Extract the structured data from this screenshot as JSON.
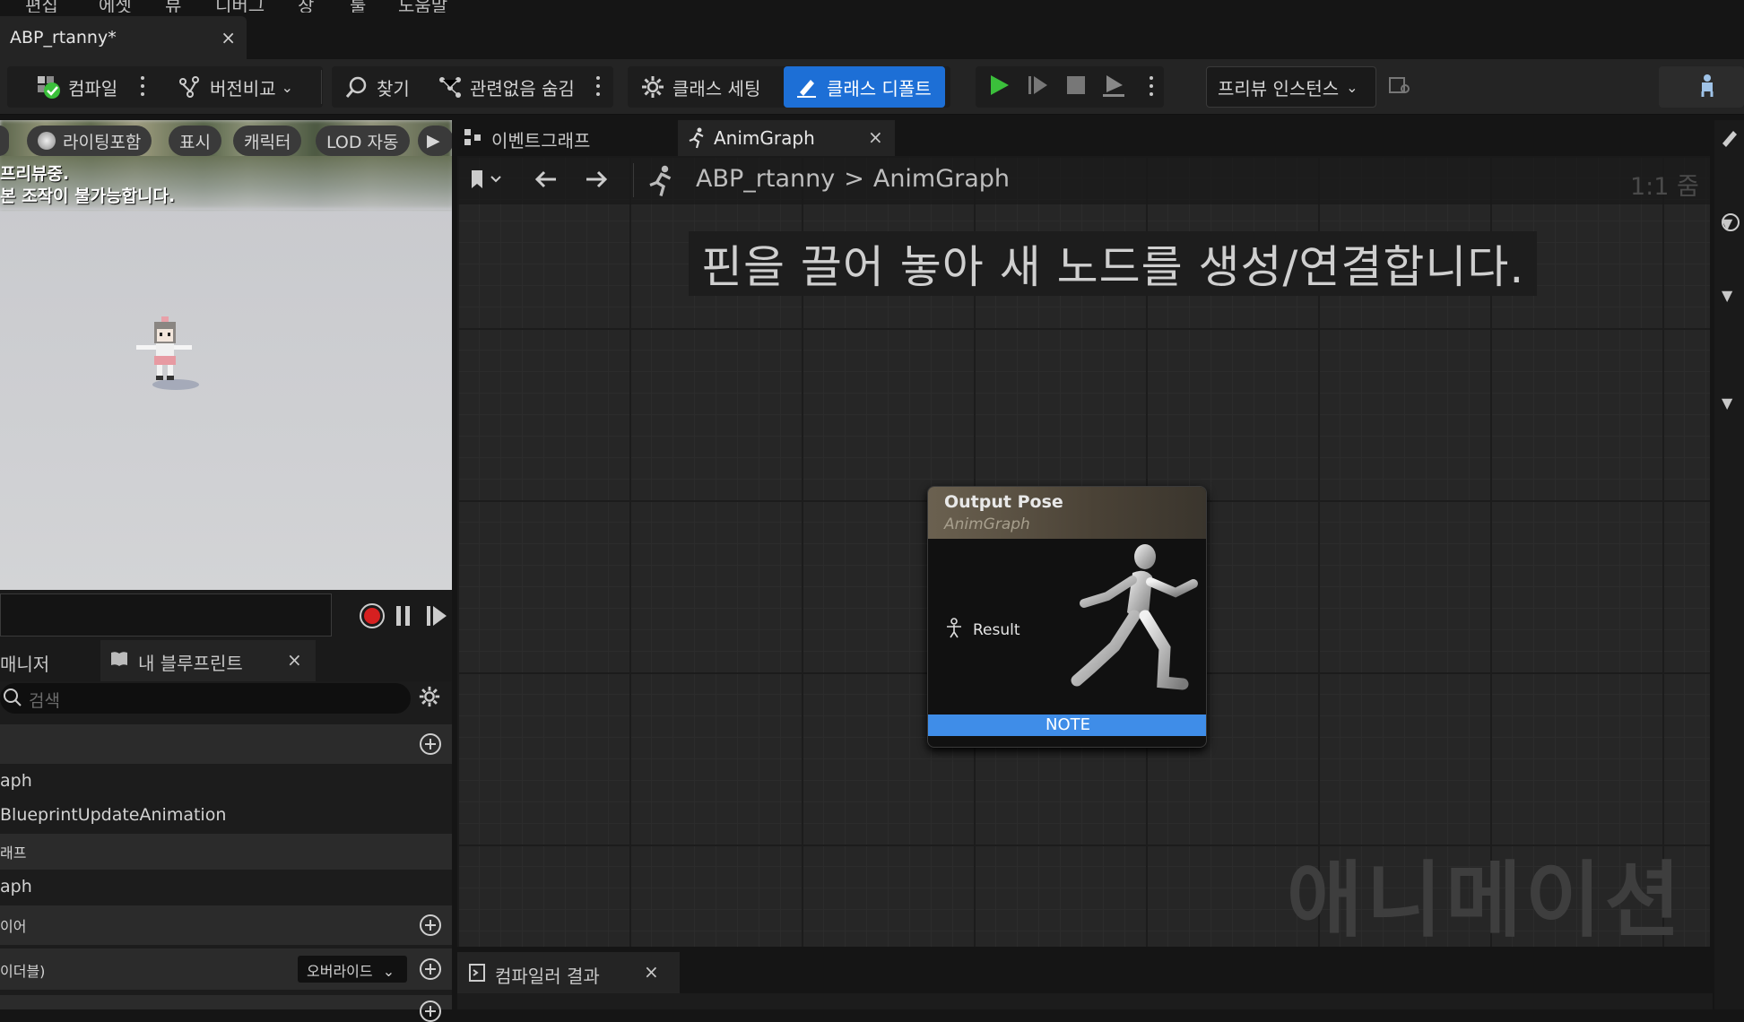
{
  "menu": [
    "편집",
    "에셋",
    "뷰",
    "디버그",
    "창",
    "툴",
    "도움말"
  ],
  "document_tab": {
    "title": "ABP_rtanny*",
    "close": "×"
  },
  "toolbar": {
    "compile": "컴파일",
    "diff": "버전비교",
    "find": "찾기",
    "hide_unrelated": "관련없음 숨김",
    "class_settings": "클래스 세팅",
    "class_defaults": "클래스 디폴트",
    "preview_instance": "프리뷰 인스턴스"
  },
  "viewport": {
    "pills": [
      "라이팅포함",
      "표시",
      "캐릭터",
      "LOD 자동"
    ],
    "message_line1": "프리뷰중.",
    "message_line2": "본 조작이 불가능합니다."
  },
  "panel_tabs": {
    "left": "매니저",
    "my_blueprint": "내 블루프린트",
    "close": "×"
  },
  "panel": {
    "search_placeholder": "검색",
    "rows": [
      {
        "text": "aph"
      },
      {
        "text": "BlueprintUpdateAnimation"
      },
      {
        "text": "래프"
      },
      {
        "text": "aph"
      },
      {
        "text": "이어"
      },
      {
        "text": "이더블)"
      }
    ],
    "override_label": "오버라이드"
  },
  "graph_tabs": {
    "event_graph": "이벤트그래프",
    "anim_graph": "AnimGraph",
    "close": "×"
  },
  "breadcrumb": {
    "asset": "ABP_rtanny",
    "sep": ">",
    "graph": "AnimGraph",
    "zoom": "1:1 줌"
  },
  "hint": "핀을 끌어 놓아 새 노드를 생성/연결합니다.",
  "node": {
    "title": "Output Pose",
    "subtitle": "AnimGraph",
    "pin": "Result",
    "note": "NOTE"
  },
  "watermark": "애니메이션",
  "compiler": {
    "title": "컴파일러 결과",
    "close": "×"
  },
  "colors": {
    "accent_blue": "#1d6fd6",
    "play_green": "#3bbf3b",
    "record_red": "#d62020",
    "note_blue": "#3f8de8"
  }
}
